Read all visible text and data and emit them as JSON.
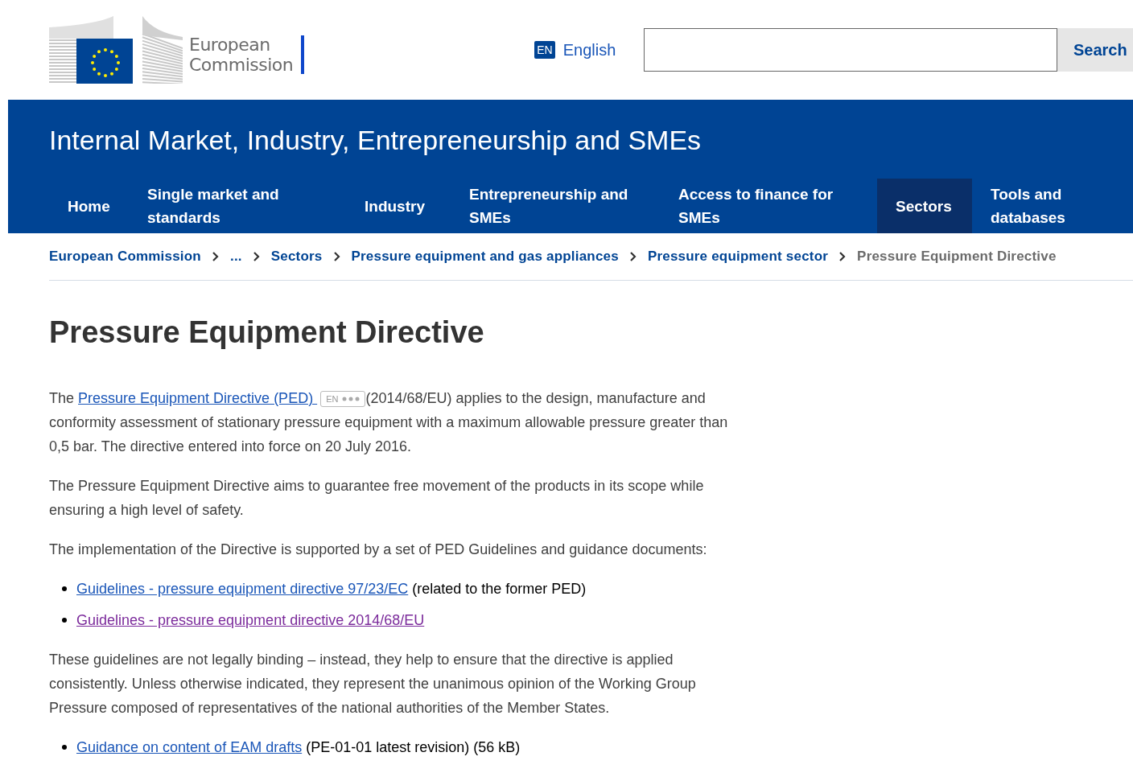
{
  "header": {
    "logo_text": [
      "European",
      "Commission"
    ],
    "language": {
      "code": "EN",
      "label": "English"
    },
    "search": {
      "button": "Search"
    }
  },
  "site_title": "Internal Market, Industry, Entrepreneurship and SMEs",
  "nav": [
    {
      "label": "Home",
      "selected": false
    },
    {
      "label": "Single market and standards",
      "selected": false
    },
    {
      "label": "Industry",
      "selected": false
    },
    {
      "label": "Entrepreneurship and SMEs",
      "selected": false
    },
    {
      "label": "Access to finance for SMEs",
      "selected": false
    },
    {
      "label": "Sectors",
      "selected": true
    },
    {
      "label": "Tools and databases",
      "selected": false
    }
  ],
  "breadcrumb": [
    {
      "label": "European Commission",
      "current": false
    },
    {
      "label": "...",
      "current": false
    },
    {
      "label": "Sectors",
      "current": false
    },
    {
      "label": "Pressure equipment and gas appliances",
      "current": false
    },
    {
      "label": "Pressure equipment sector",
      "current": false
    },
    {
      "label": "Pressure Equipment Directive",
      "current": true
    }
  ],
  "page_title": "Pressure Equipment Directive",
  "content": [
    {
      "kind": "paragraph",
      "before": "The ",
      "link": "Pressure Equipment Directive (PED) ",
      "badge": "EN",
      "after": "(2014/68/EU) applies to the design, manufacture and conformity assessment of stationary pressure equipment with a maximum allowable pressure greater than 0,5 bar. The directive entered into force on 20 July 2016."
    },
    {
      "kind": "paragraph",
      "text": "The Pressure Equipment Directive aims to guarantee free movement of the products in its scope while ensuring a high level of safety."
    },
    {
      "kind": "paragraph",
      "text": "The implementation of the Directive is supported by a set of PED Guidelines and guidance documents:"
    },
    {
      "kind": "list",
      "items": [
        {
          "link": "Guidelines - pressure equipment directive 97/23/EC",
          "visited": false,
          "after": " (related to the former PED)"
        },
        {
          "link": "Guidelines - pressure equipment directive 2014/68/EU",
          "visited": true
        }
      ]
    },
    {
      "kind": "paragraph",
      "text": "These guidelines are not legally binding – instead, they help to ensure that the directive is applied consistently. Unless otherwise indicated, they represent the unanimous opinion of the Working Group Pressure composed of representatives of the national authorities of the Member States."
    },
    {
      "kind": "list",
      "items": [
        {
          "link": "Guidance on content of EAM drafts",
          "visited": false,
          "after": " (PE-01-01 latest revision) (56 kB)"
        }
      ]
    }
  ]
}
